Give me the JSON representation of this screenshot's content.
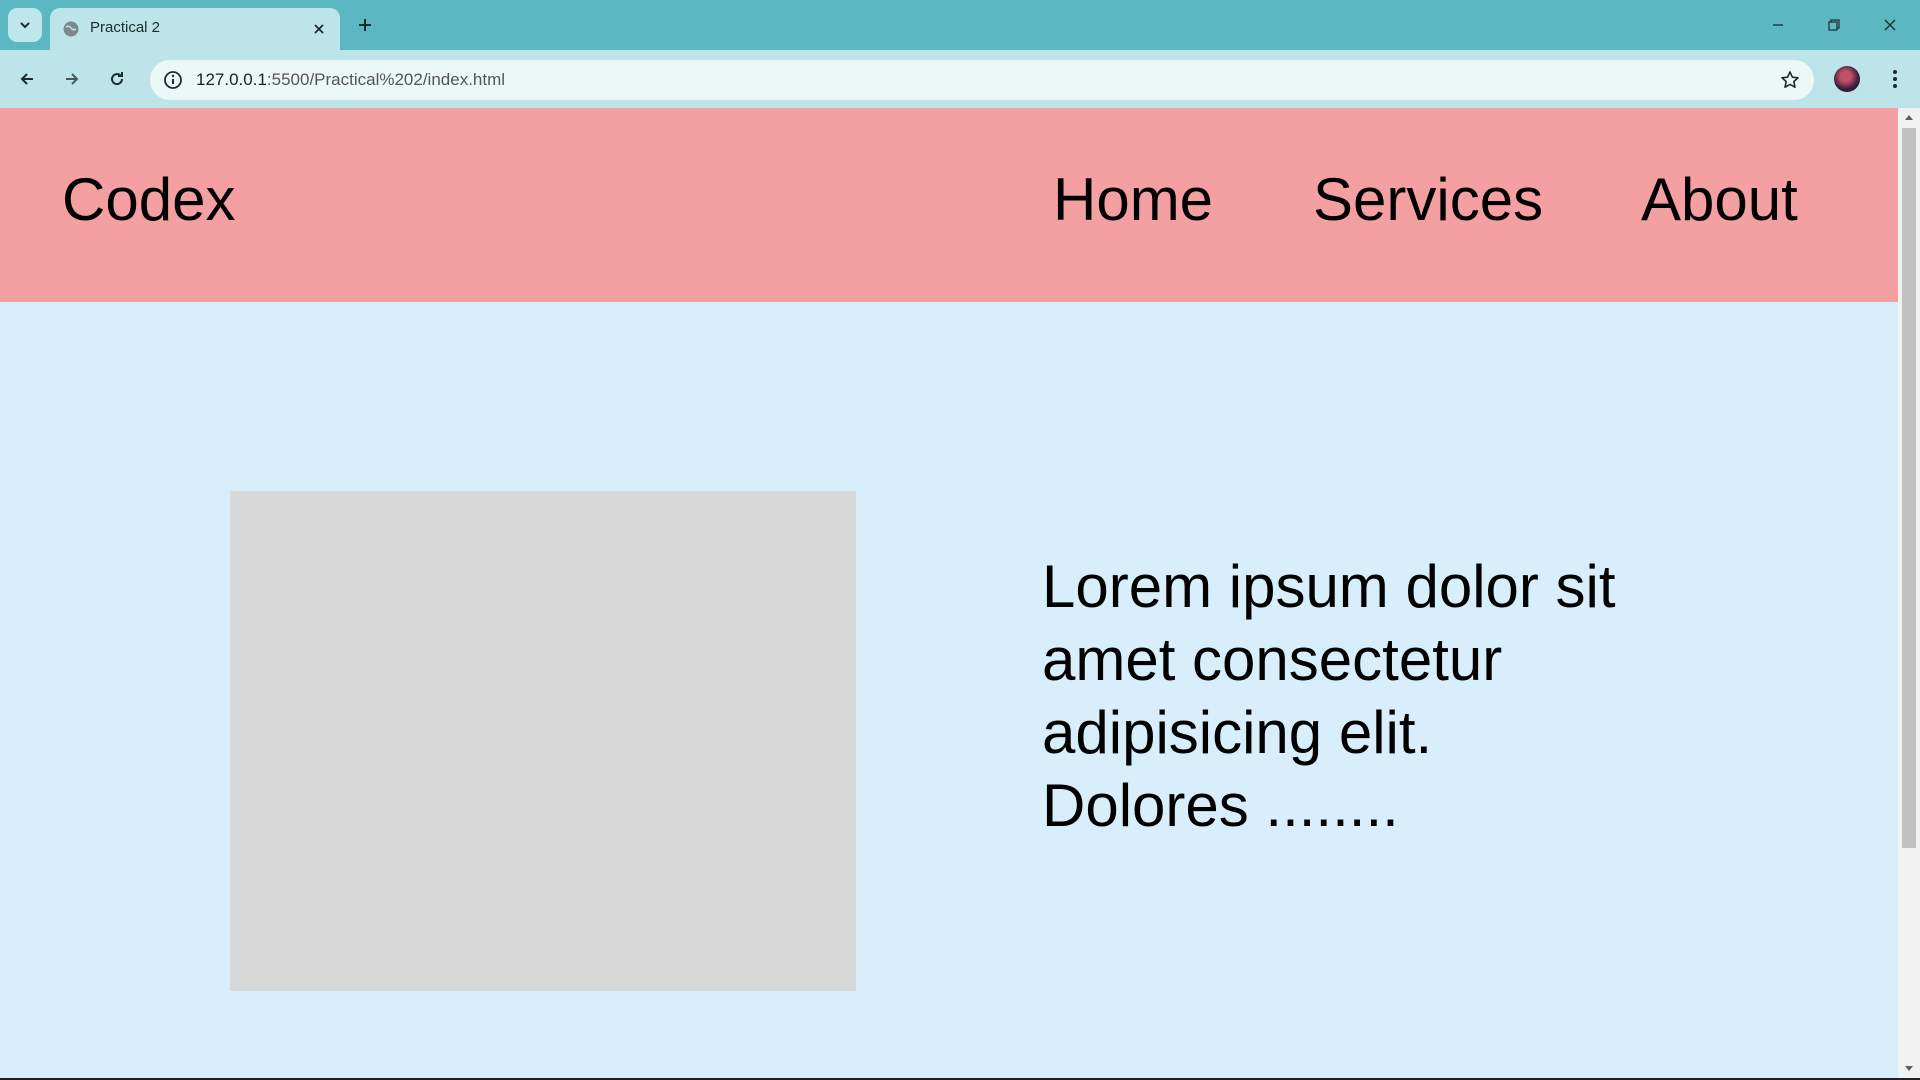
{
  "browser": {
    "tab_title": "Practical 2",
    "url_host": "127.0.0.1",
    "url_path": ":5500/Practical%202/index.html",
    "icons": {
      "tab_search": "chevron-down-icon",
      "favicon": "globe-icon",
      "close_tab": "close-icon",
      "new_tab": "plus-icon",
      "minimize": "minimize-icon",
      "restore": "restore-icon",
      "close_window": "close-icon",
      "back": "arrow-left-icon",
      "forward": "arrow-right-icon",
      "reload": "reload-icon",
      "site_info": "info-icon",
      "bookmark": "star-icon",
      "profile": "avatar",
      "menu": "kebab-menu-icon"
    },
    "colors": {
      "tabstrip": "#5bb8c2",
      "toolbar": "#bde5e9"
    }
  },
  "page": {
    "brand": "Codex",
    "nav": [
      {
        "label": "Home"
      },
      {
        "label": "Services"
      },
      {
        "label": "About"
      }
    ],
    "hero_text": "Lorem ipsum dolor sit amet consectetur adipisicing elit. Dolores ........",
    "colors": {
      "header_bg": "#f49fa2",
      "body_bg": "#d9eefb",
      "image_placeholder": "#d8d8d8"
    }
  }
}
